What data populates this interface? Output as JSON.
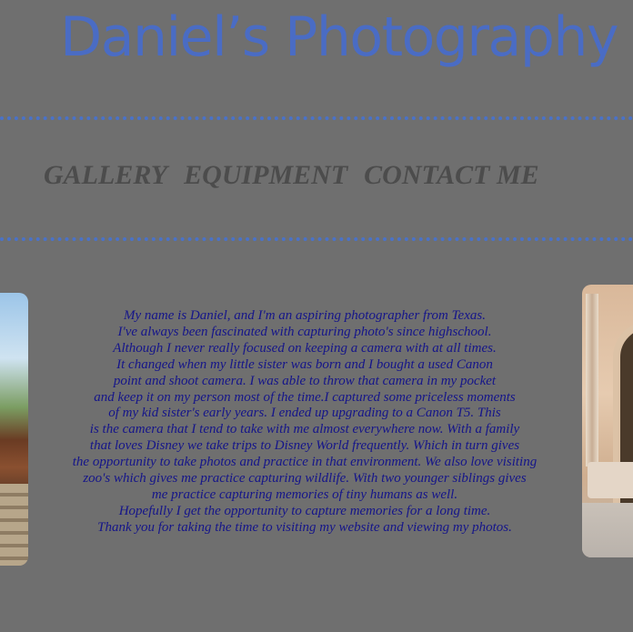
{
  "header": {
    "title": "Daniel’s Photography"
  },
  "nav": {
    "items": [
      {
        "label": "GALLERY"
      },
      {
        "label": "EQUIPMENT"
      },
      {
        "label": "CONTACT ME"
      }
    ]
  },
  "about": {
    "lines": [
      "My name is Daniel, and I'm an aspiring photographer from Texas.",
      "I've always been fascinated with capturing photo's since highschool.",
      "Although I never really focused on keeping a camera with at all times.",
      "It changed when my little sister was born and I bought a used Canon",
      "point and shoot camera. I was able to throw that camera in my pocket",
      "and keep it on my person most of the time.I captured some priceless moments",
      "of my kid sister's early years. I ended up upgrading to a Canon T5. This",
      "is the camera that I tend to take with me almost everywhere now. With a family",
      "that loves Disney we take trips to Disney World frequently. Which in turn gives",
      "the opportunity to take photos and practice in that environment. We also love visiting",
      "zoo's which gives me practice capturing wildlife. With two younger siblings gives",
      "me practice capturing memories of tiny humans as well.",
      "Hopefully I get the opportunity to capture memories for a long time.",
      "Thank you for taking the time to visiting my website and viewing my photos."
    ]
  },
  "colors": {
    "background": "#6f6f6f",
    "title": "#4a6cc4",
    "divider": "#4a72c8",
    "nav": "#4c4c4c",
    "body_text": "#15158a"
  }
}
